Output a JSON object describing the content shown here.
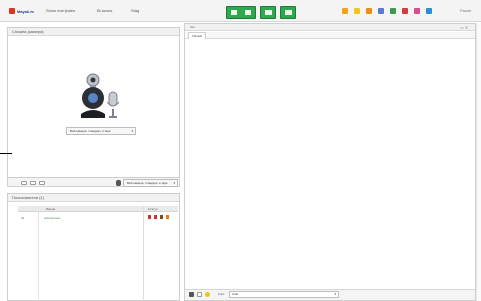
{
  "app": {
    "logo_text": "Mayak.tv"
  },
  "menu": [
    {
      "label": "Show mai ljudes"
    },
    {
      "label": "Bi azoos"
    },
    {
      "label": "Stag"
    }
  ],
  "top_right": {
    "exit_label": "Pause"
  },
  "camera_panel": {
    "title": "Сюзана (камера)",
    "camera_select": "Веб-камера, стандарт. и звук.",
    "mic_select": "Веб-камера, стандарт. и звук."
  },
  "users_panel": {
    "title": "Пользователи (1)",
    "columns": [
      "Имена",
      "Статус"
    ],
    "rows": [
      {
        "num": "01",
        "name": "Anonymous"
      }
    ]
  },
  "chat": {
    "title": "Чат",
    "tab": "Общий",
    "controls": "▭ ✕",
    "font_label": "Font:",
    "font_value": "Arial"
  },
  "colors": {
    "green": "#2fa84f",
    "accent_red": "#d9381e"
  }
}
